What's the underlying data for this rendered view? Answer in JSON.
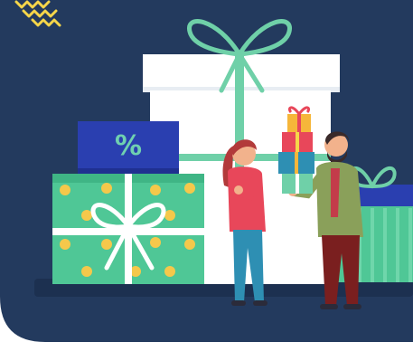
{
  "illustration": {
    "discount_tag_text": "%",
    "colors": {
      "background_panel": "#233a5e",
      "white_box": "#ffffff",
      "box_shadow": "#e8edf3",
      "ribbon_green": "#6fd0a8",
      "green_box": "#4fc796",
      "yellow_dots": "#f5c84b",
      "blue_tag": "#2a3fb0",
      "woman_top": "#e8475a",
      "woman_pants": "#2e8fb3",
      "man_jacket": "#8aa05a",
      "man_pants": "#7a1f1f",
      "hair_red": "#b23a3a",
      "skin": "#f2b28c",
      "accent_yellow": "#f6d64a"
    }
  }
}
